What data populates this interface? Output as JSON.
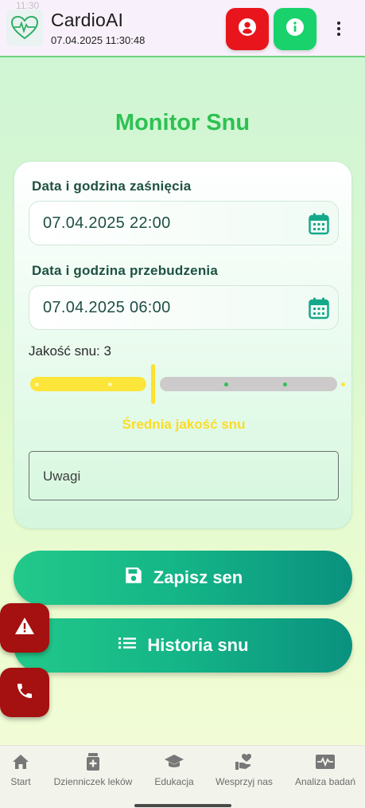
{
  "status_bar": {
    "time": "11:30"
  },
  "app_bar": {
    "title": "CardioAI",
    "datetime": "07.04.2025 11:30:48",
    "icons": [
      "heart-logo-icon",
      "profile-icon",
      "info-icon",
      "more-vert-icon"
    ],
    "colors": {
      "profile_button": "#e8151c",
      "info_button": "#19d26b"
    }
  },
  "page": {
    "title": "Monitor Snu",
    "title_color": "#2ec152"
  },
  "form": {
    "sleep_start_label": "Data i godzina zaśnięcia",
    "sleep_start_value": "07.04.2025 22:00",
    "wake_label": "Data i godzina przebudzenia",
    "wake_value": "07.04.2025 06:00",
    "quality_label": "Jakość snu: 3",
    "quality": {
      "value": 3,
      "min": 1,
      "max": 5
    },
    "quality_description": "Średnia jakość snu",
    "quality_color": "#fde53a",
    "notes_placeholder": "Uwagi"
  },
  "actions": {
    "save_label": "Zapisz sen",
    "history_label": "Historia snu",
    "save_icon": "save-icon",
    "history_icon": "list-icon"
  },
  "fabs": [
    {
      "icon": "warning-icon"
    },
    {
      "icon": "phone-icon"
    }
  ],
  "bottom_nav": {
    "items": [
      {
        "label": "Start",
        "icon": "home-icon"
      },
      {
        "label": "Dzienniczek leków",
        "icon": "medication-icon"
      },
      {
        "label": "Edukacja",
        "icon": "school-icon"
      },
      {
        "label": "Wesprzyj nas",
        "icon": "volunteer-icon"
      },
      {
        "label": "Analiza badań",
        "icon": "monitor-heart-icon"
      }
    ]
  }
}
